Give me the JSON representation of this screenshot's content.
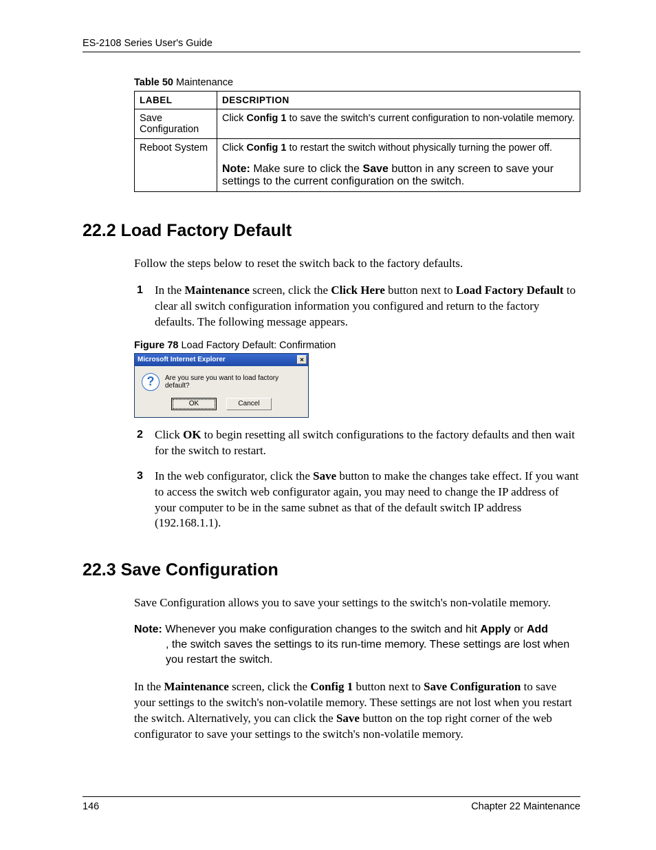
{
  "header": {
    "running_head": "ES-2108 Series User's Guide"
  },
  "table": {
    "caption_strong": "Table 50",
    "caption_rest": "   Maintenance",
    "headers": {
      "label": "LABEL",
      "description": "DESCRIPTION"
    },
    "rows": [
      {
        "label": "Save Configuration",
        "desc_pre": "Click ",
        "desc_bold": "Config 1",
        "desc_post": " to save the switch's current configuration to non-volatile memory."
      },
      {
        "label": "Reboot System",
        "desc_pre": "Click ",
        "desc_bold": "Config 1",
        "desc_post": " to restart the switch without physically turning the power off.",
        "note_label": "Note:",
        "note_pre": " Make sure to click the ",
        "note_bold": "Save",
        "note_post": " button in any screen to save your settings to the current configuration on the switch."
      }
    ]
  },
  "section22_2": {
    "heading": "22.2  Load Factory Default",
    "intro": "Follow the steps below to reset the switch back to the factory defaults.",
    "step1": {
      "num": "1",
      "t1": "In the ",
      "b1": "Maintenance",
      "t2": " screen, click the ",
      "b2": "Click Here",
      "t3": " button next to ",
      "b3": "Load Factory Default",
      "t4": " to clear all switch configuration information you configured and return to the factory defaults. The following message appears."
    },
    "figure": {
      "caption_strong": "Figure 78",
      "caption_rest": "   Load Factory Default: Confirmation",
      "dialog_title": "Microsoft Internet Explorer",
      "dialog_msg": "Are you sure you want to load factory default?",
      "ok": "OK",
      "cancel": "Cancel",
      "close": "×"
    },
    "step2": {
      "num": "2",
      "t1": "Click ",
      "b1": "OK",
      "t2": " to begin resetting all switch configurations to the factory defaults and then wait for the switch to restart."
    },
    "step3": {
      "num": "3",
      "t1": "In the web configurator, click the ",
      "b1": "Save",
      "t2": " button to make the changes take effect. If you want to access the switch web configurator again, you may need to change the IP address of your computer to be in the same subnet as that of the default switch IP address (192.168.1.1)."
    }
  },
  "section22_3": {
    "heading": "22.3  Save Configuration",
    "p1": "Save Configuration allows you to save your settings to the switch's non-volatile memory.",
    "note": {
      "label": "Note:",
      "t1": " Whenever you make configuration changes to the switch and hit ",
      "b1": "Apply",
      "t2": " or ",
      "b2": "Add",
      "t3": ", the switch saves the settings to its run-time memory. These settings are lost when you restart the switch."
    },
    "p2": {
      "t1": "In the ",
      "b1": "Maintenance",
      "t2": " screen, click the ",
      "b2": "Config 1",
      "t3": " button next to ",
      "b3": "Save Configuration",
      "t4": " to save your settings to the switch's non-volatile memory. These settings are not lost when you restart the switch. Alternatively, you can click the ",
      "b4": "Save",
      "t5": " button on the top right corner of the web configurator to save your settings to the switch's non-volatile memory."
    }
  },
  "footer": {
    "page_number": "146",
    "chapter": "Chapter 22 Maintenance"
  }
}
